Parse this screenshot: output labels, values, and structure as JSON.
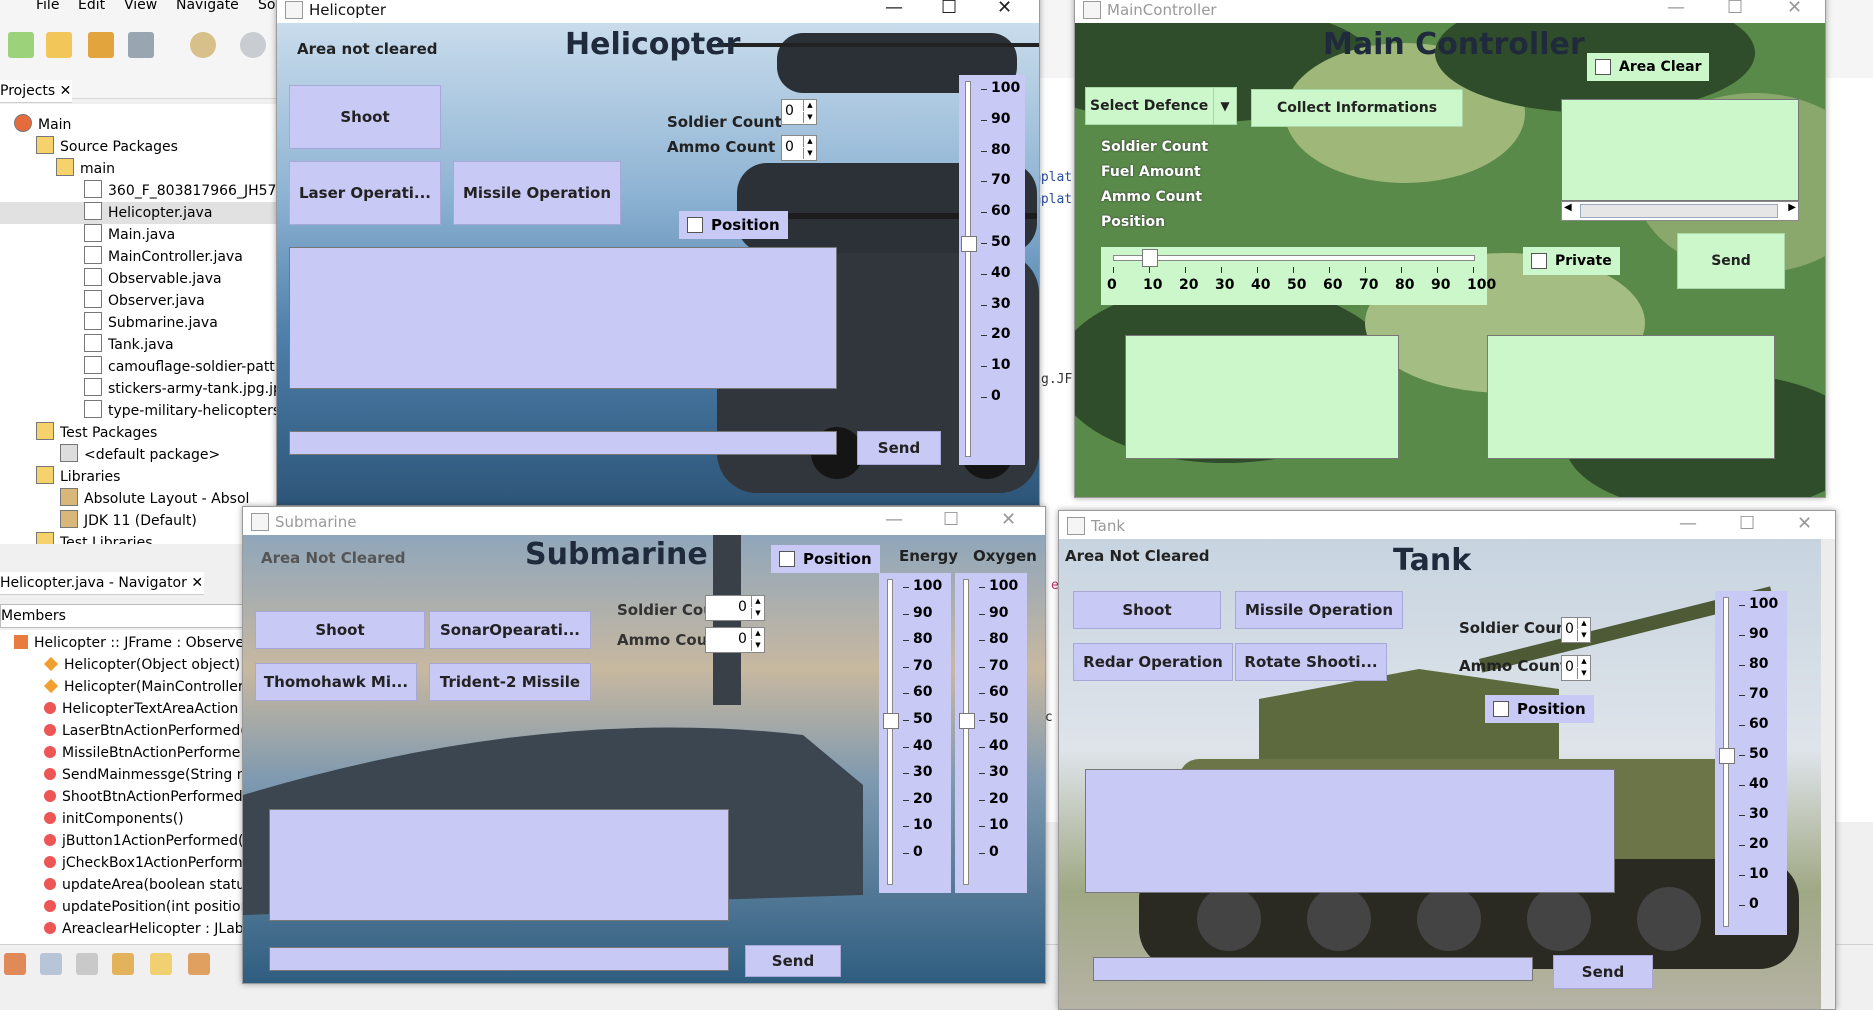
{
  "ide": {
    "menu": [
      "File",
      "Edit",
      "View",
      "Navigate",
      "So"
    ],
    "projects_tab": "Projects",
    "tree": [
      {
        "label": "Main",
        "indent": 1
      },
      {
        "label": "Source Packages",
        "indent": 2
      },
      {
        "label": "main",
        "indent": 3
      },
      {
        "label": "360_F_803817966_JH577",
        "indent": 4
      },
      {
        "label": "Helicopter.java",
        "indent": 4,
        "selected": true
      },
      {
        "label": "Main.java",
        "indent": 4
      },
      {
        "label": "MainController.java",
        "indent": 4
      },
      {
        "label": "Observable.java",
        "indent": 4
      },
      {
        "label": "Observer.java",
        "indent": 4
      },
      {
        "label": "Submarine.java",
        "indent": 4
      },
      {
        "label": "Tank.java",
        "indent": 4
      },
      {
        "label": "camouflage-soldier-patt",
        "indent": 4
      },
      {
        "label": "stickers-army-tank.jpg.jp",
        "indent": 4
      },
      {
        "label": "type-military-helicopters",
        "indent": 4
      },
      {
        "label": "Test Packages",
        "indent": 2
      },
      {
        "label": "<default package>",
        "indent": 3
      },
      {
        "label": "Libraries",
        "indent": 2
      },
      {
        "label": "Absolute Layout - Absol",
        "indent": 3
      },
      {
        "label": "JDK 11 (Default)",
        "indent": 3
      },
      {
        "label": "Test Libraries",
        "indent": 2
      }
    ],
    "navigator_tab": "Helicopter.java - Navigator",
    "members_label": "Members",
    "nav_items": [
      {
        "label": "Helicopter :: JFrame : Observer",
        "kind": "class"
      },
      {
        "label": "Helicopter(Object object)",
        "kind": "ctor"
      },
      {
        "label": "Helicopter(MainController",
        "kind": "ctor"
      },
      {
        "label": "HelicopterTextAreaAction",
        "kind": "method"
      },
      {
        "label": "LaserBtnActionPerformed(",
        "kind": "method"
      },
      {
        "label": "MissileBtnActionPerforme",
        "kind": "method"
      },
      {
        "label": "SendMainmessge(String m",
        "kind": "method"
      },
      {
        "label": "ShootBtnActionPerformed",
        "kind": "method"
      },
      {
        "label": "initComponents()",
        "kind": "method"
      },
      {
        "label": "jButton1ActionPerformed(",
        "kind": "method"
      },
      {
        "label": "jCheckBox1ActionPerform",
        "kind": "method"
      },
      {
        "label": "updateArea(boolean statu",
        "kind": "method"
      },
      {
        "label": "updatePosition(int position",
        "kind": "method"
      },
      {
        "label": "AreaclearHelicopter : JLab",
        "kind": "method"
      }
    ],
    "editor_fragments": [
      "mplat",
      "mplat",
      "g.JF",
      "er",
      "ec"
    ]
  },
  "helicopter": {
    "window_title": "Helicopter",
    "heading": "Helicopter",
    "area_status": "Area not cleared",
    "shoot": "Shoot",
    "laser": "Laser Operati...",
    "missile": "Missile Operation",
    "soldier_label": "Soldier  Count",
    "ammo_label": "Ammo Count",
    "soldier_value": "0",
    "ammo_value": "0",
    "position_label": "Position",
    "send": "Send",
    "slider_ticks": [
      "100",
      "90",
      "80",
      "70",
      "60",
      "50",
      "40",
      "30",
      "20",
      "10",
      "0"
    ],
    "slider_value": 50
  },
  "main_controller": {
    "window_title": "MainController",
    "heading": "Main Controller",
    "select_defence": "Select Defence",
    "collect": "Collect Informations",
    "area_clear": "Area Clear",
    "labels": [
      "Soldier Count",
      "Fuel Amount",
      "Ammo Count",
      "Position"
    ],
    "private": "Private",
    "send": "Send",
    "slider_ticks": [
      "0",
      "10",
      "20",
      "30",
      "40",
      "50",
      "60",
      "70",
      "80",
      "90",
      "100"
    ],
    "slider_value": 10
  },
  "submarine": {
    "window_title": "Submarine",
    "heading": "Submarine",
    "area_status": "Area Not Cleared",
    "shoot": "Shoot",
    "sonar": "SonarOpearati...",
    "tomahawk": "Thomohawk Mi...",
    "trident": "Trident-2 Missile",
    "soldier_label": "Soldier Coun",
    "ammo_label": "Ammo Count",
    "soldier_value": "0",
    "ammo_value": "0",
    "position_label": "Position",
    "energy_label": "Energy",
    "oxygen_label": "Oxygen",
    "send": "Send",
    "slider_ticks": [
      "100",
      "90",
      "80",
      "70",
      "60",
      "50",
      "40",
      "30",
      "20",
      "10",
      "0"
    ],
    "energy_value": 50,
    "oxygen_value": 50
  },
  "tank": {
    "window_title": "Tank",
    "heading": "Tank",
    "area_status": "Area Not Cleared",
    "shoot": "Shoot",
    "missile": "Missile Operation",
    "redar": "Redar Operation",
    "rotate": "Rotate Shooti...",
    "soldier_label": "Soldier Count",
    "ammo_label": "Ammo Count",
    "soldier_value": "0",
    "ammo_value": "0",
    "position_label": "Position",
    "send": "Send",
    "slider_ticks": [
      "100",
      "90",
      "80",
      "70",
      "60",
      "50",
      "40",
      "30",
      "20",
      "10",
      "0"
    ],
    "slider_value": 50
  }
}
